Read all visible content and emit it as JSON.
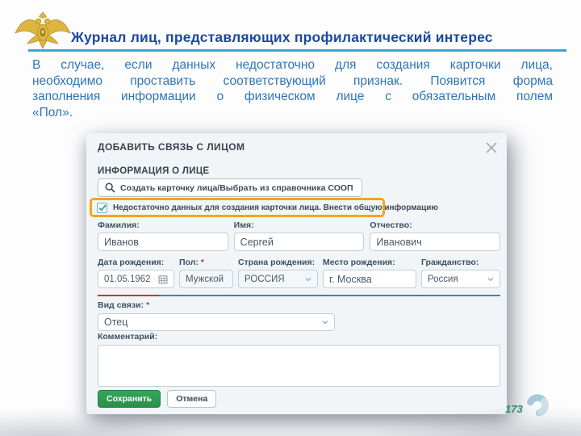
{
  "slide": {
    "title": "Журнал лиц, представляющих профилактический интерес",
    "body_lines": [
      "В случае, если данных недостаточно для создания карточки лица,",
      "необходимо проставить соответствующий признак. Появится форма",
      "заполнения информации о физическом лице с обязательным полем",
      "«Пол»."
    ],
    "page_number": "173"
  },
  "dialog": {
    "title": "ДОБАВИТЬ СВЯЗЬ С ЛИЦОМ",
    "section_heading": "ИНФОРМАЦИЯ О ЛИЦЕ",
    "search_button_label": "Создать карточку лица/Выбрать из справочника СООП",
    "checkbox": {
      "checked": true,
      "label": "Недостаточно данных для создания карточки лица. Внести общую информацию"
    },
    "fields": {
      "surname": {
        "label": "Фамилия:",
        "value": "Иванов"
      },
      "name": {
        "label": "Имя:",
        "value": "Сергей"
      },
      "patronymic": {
        "label": "Отчество:",
        "value": "Иванович"
      },
      "birth_date": {
        "label": "Дата рождения:",
        "value": "01.05.1962"
      },
      "gender": {
        "label": "Пол:",
        "required_mark": "*",
        "value": "Мужской"
      },
      "birth_country": {
        "label": "Страна рождения:",
        "value": "РОССИЯ"
      },
      "birth_place": {
        "label": "Место рождения:",
        "value": "г. Москва"
      },
      "citizenship": {
        "label": "Гражданство:",
        "value": "Россия"
      },
      "relation_type": {
        "label": "Вид связи:",
        "required_mark": "*",
        "value": "Отец"
      },
      "comment": {
        "label": "Комментарий:",
        "value": ""
      }
    },
    "buttons": {
      "save": "Сохранить",
      "cancel": "Отмена"
    }
  },
  "icons": {
    "logo": "mvd-eagle-emblem",
    "search": "magnifier",
    "close": "x-cross",
    "calendar": "calendar-grid",
    "chevron": "chevron-down",
    "check": "checkmark",
    "swirl": "swirl-arc"
  },
  "colors": {
    "title_blue": "#1b4a9b",
    "body_blue": "#2e75b6",
    "underline_blue": "#38a7d7",
    "highlight_orange": "#efa71d",
    "check_teal": "#2aa198",
    "divider_red": "#c0392b",
    "divider_blue": "#4a7fa8",
    "save_green": "#2f9e53",
    "page_number_teal": "#2c8c74",
    "logo_gold": "#ddb63f"
  }
}
